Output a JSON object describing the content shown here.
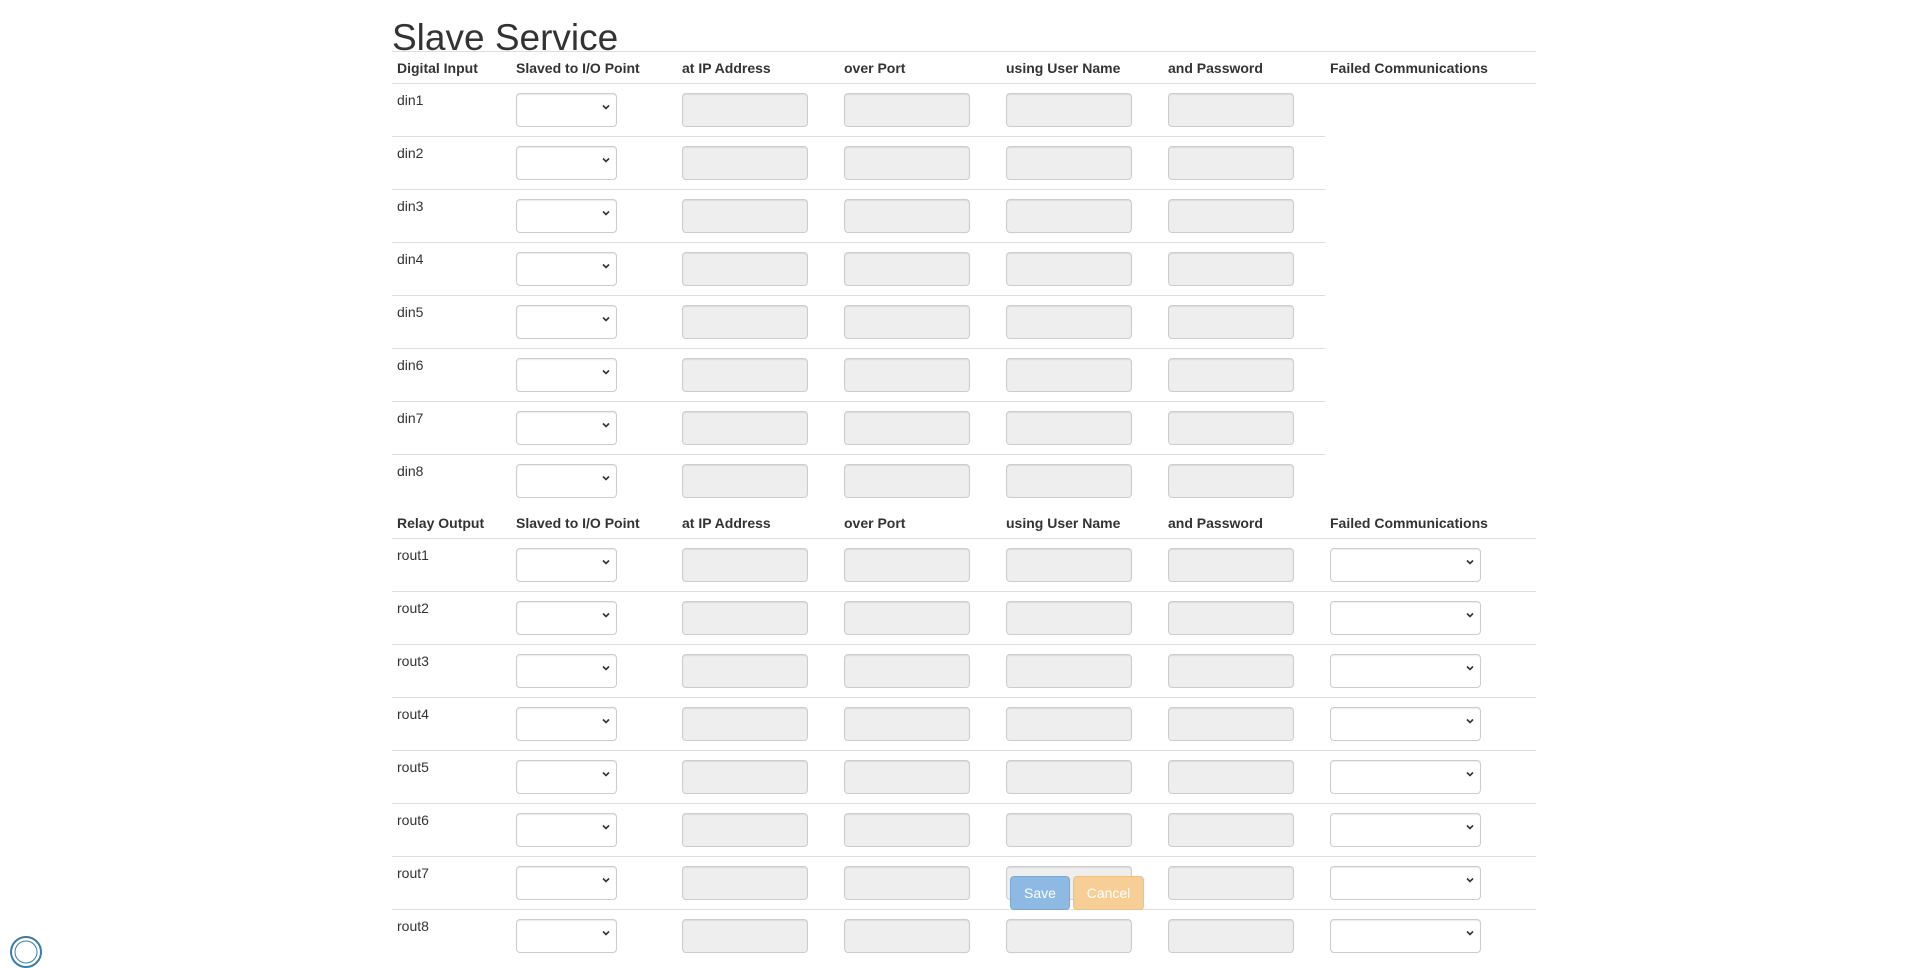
{
  "page": {
    "title": "Slave Service"
  },
  "colors": {
    "save_bg": "#8db9e2",
    "cancel_bg": "#f6ce96",
    "disabled_input": "#eeeeee",
    "border": "#dddddd"
  },
  "digital_section": {
    "headers": [
      "Digital Input",
      "Slaved to I/O Point",
      "at IP Address",
      "over Port",
      "using User Name",
      "and Password",
      "Failed Communications"
    ],
    "rows": [
      "din1",
      "din2",
      "din3",
      "din4",
      "din5",
      "din6",
      "din7",
      "din8"
    ]
  },
  "relay_section": {
    "headers": [
      "Relay Output",
      "Slaved to I/O Point",
      "at IP Address",
      "over Port",
      "using User Name",
      "and Password",
      "Failed Communications"
    ],
    "rows": [
      "rout1",
      "rout2",
      "rout3",
      "rout4",
      "rout5",
      "rout6",
      "rout7",
      "rout8"
    ]
  },
  "actions": {
    "save_label": "Save",
    "cancel_label": "Cancel"
  },
  "icons": {
    "select_arrow": "chevron-down-icon",
    "corner": "logo-icon"
  }
}
